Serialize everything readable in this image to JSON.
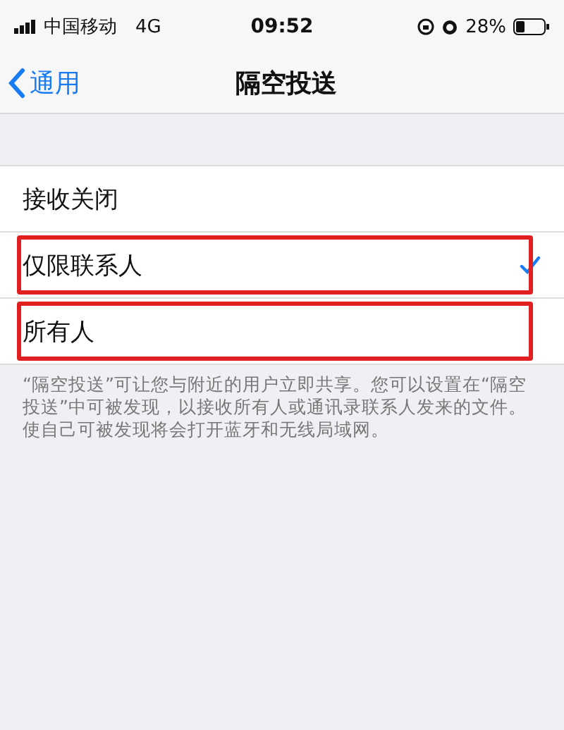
{
  "status_bar": {
    "carrier": "中国移动",
    "network": "4G",
    "time": "09:52",
    "battery": "28%"
  },
  "nav": {
    "back": "通用",
    "title": "隔空投送"
  },
  "options": [
    {
      "label": "接收关闭",
      "selected": false,
      "highlighted": false
    },
    {
      "label": "仅限联系人",
      "selected": true,
      "highlighted": true
    },
    {
      "label": "所有人",
      "selected": false,
      "highlighted": true
    }
  ],
  "footer": "“隔空投送”可让您与附近的用户立即共享。您可以设置在“隔空投送”中可被发现，以接收所有人或通讯录联系人发来的文件。使自己可被发现将会打开蓝牙和无线局域网。"
}
